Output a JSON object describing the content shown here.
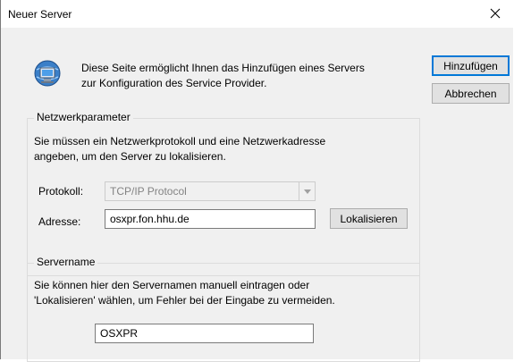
{
  "dialog": {
    "title": "Neuer Server",
    "intro_line1": "Diese Seite ermöglicht Ihnen das Hinzufügen eines Servers",
    "intro_line2": "zur Konfiguration des Service Provider."
  },
  "buttons": {
    "add": "Hinzufügen",
    "cancel": "Abbrechen",
    "locate": "Lokalisieren"
  },
  "network_group": {
    "title": "Netzwerkparameter",
    "description_line1": "Sie müssen ein Netzwerkprotokoll und eine Netzwerkadresse",
    "description_line2": "angeben, um den Server zu lokalisieren.",
    "protocol_label": "Protokoll:",
    "protocol_value": "TCP/IP Protocol",
    "address_label": "Adresse:",
    "address_value": "osxpr.fon.hhu.de"
  },
  "servername_group": {
    "title": "Servername",
    "description_line1": "Sie können hier den Servernamen manuell eintragen oder",
    "description_line2": "'Lokalisieren' wählen, um Fehler bei der Eingabe zu vermeiden.",
    "server_value": "OSXPR"
  },
  "icons": {
    "close": "close-icon",
    "app": "network-server-icon",
    "dropdown": "chevron-down-icon"
  }
}
